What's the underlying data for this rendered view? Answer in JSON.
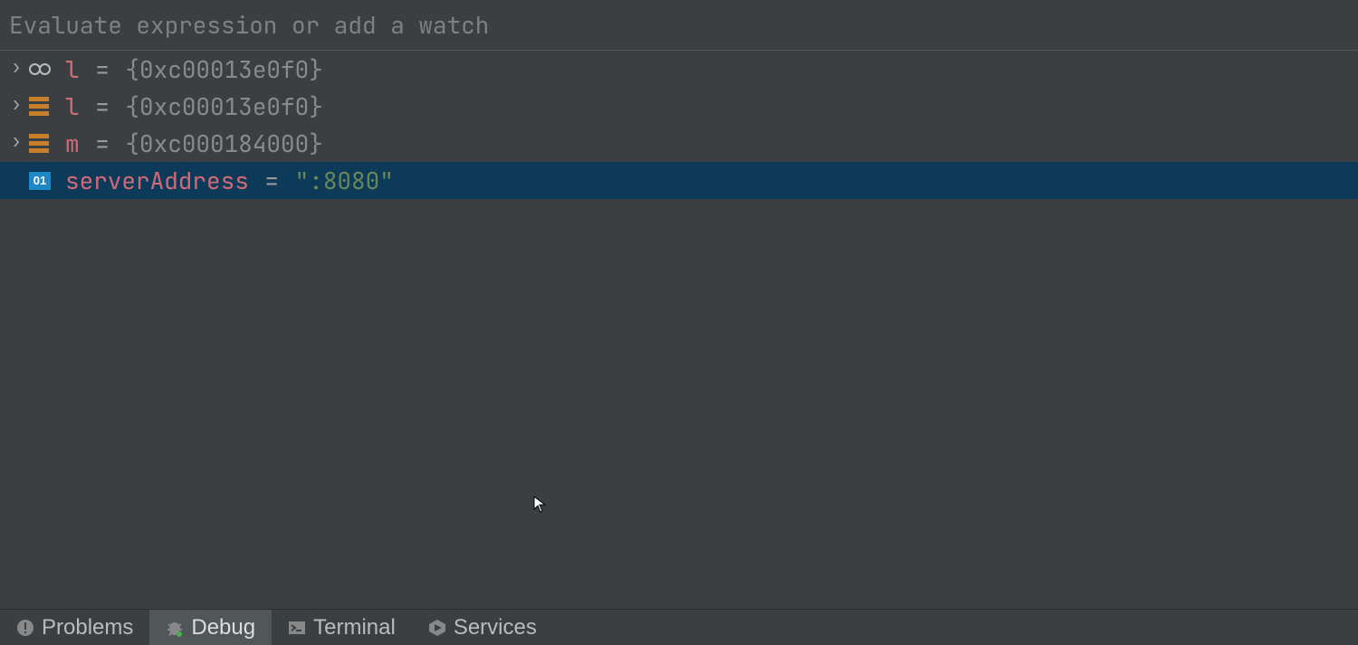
{
  "input": {
    "placeholder": "Evaluate expression or add a watch",
    "value": ""
  },
  "variables": [
    {
      "icon": "watch",
      "expand": true,
      "name": "l",
      "eq": "=",
      "value": "{0xc00013e0f0}",
      "valueClass": "val-gray",
      "selected": false
    },
    {
      "icon": "struct",
      "expand": true,
      "name": "l",
      "eq": "=",
      "value": "{0xc00013e0f0}",
      "valueClass": "val-gray",
      "selected": false
    },
    {
      "icon": "struct",
      "expand": true,
      "name": "m",
      "eq": "=",
      "value": "{0xc000184000}",
      "valueClass": "val-gray",
      "selected": false
    },
    {
      "icon": "const",
      "expand": false,
      "name": "serverAddress",
      "eq": "=",
      "value": "\":8080\"",
      "valueClass": "val-string",
      "selected": true
    }
  ],
  "const_badge": "01",
  "tabs": [
    {
      "icon": "problems",
      "label": "Problems",
      "active": false
    },
    {
      "icon": "debug",
      "label": "Debug",
      "active": true
    },
    {
      "icon": "terminal",
      "label": "Terminal",
      "active": false
    },
    {
      "icon": "services",
      "label": "Services",
      "active": false
    }
  ]
}
